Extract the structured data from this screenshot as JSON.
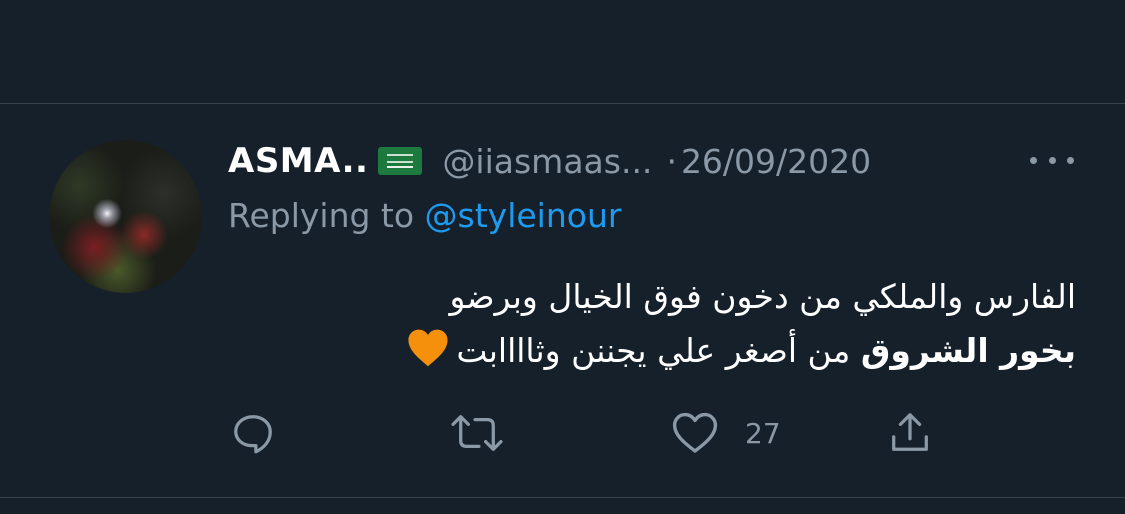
{
  "tweet": {
    "display_name": "ASMA..",
    "handle": "@iiasmaas...",
    "separator": "·",
    "date": "26/09/2020",
    "replying_prefix": "Replying to",
    "replying_to": "@styleinour",
    "text_line1": "الفارس والملكي من دخون فوق الخيال وبرضو",
    "text_line2_bold": "بخور الشروق",
    "text_line2_rest": " من أصغر علي يجننن وثاااابت",
    "emoji": "orange-heart-icon",
    "flag": "saudi-flag-icon"
  },
  "actions": {
    "reply_icon": "reply-icon",
    "retweet_icon": "retweet-icon",
    "like_icon": "like-icon",
    "like_count": "27",
    "share_icon": "share-icon",
    "more_icon": "more-icon"
  },
  "colors": {
    "background": "#15202b",
    "divider": "#38444d",
    "secondary_text": "#8b98a5",
    "link": "#1d9bf0",
    "primary_text": "#ffffff",
    "heart": "#f4900c"
  }
}
